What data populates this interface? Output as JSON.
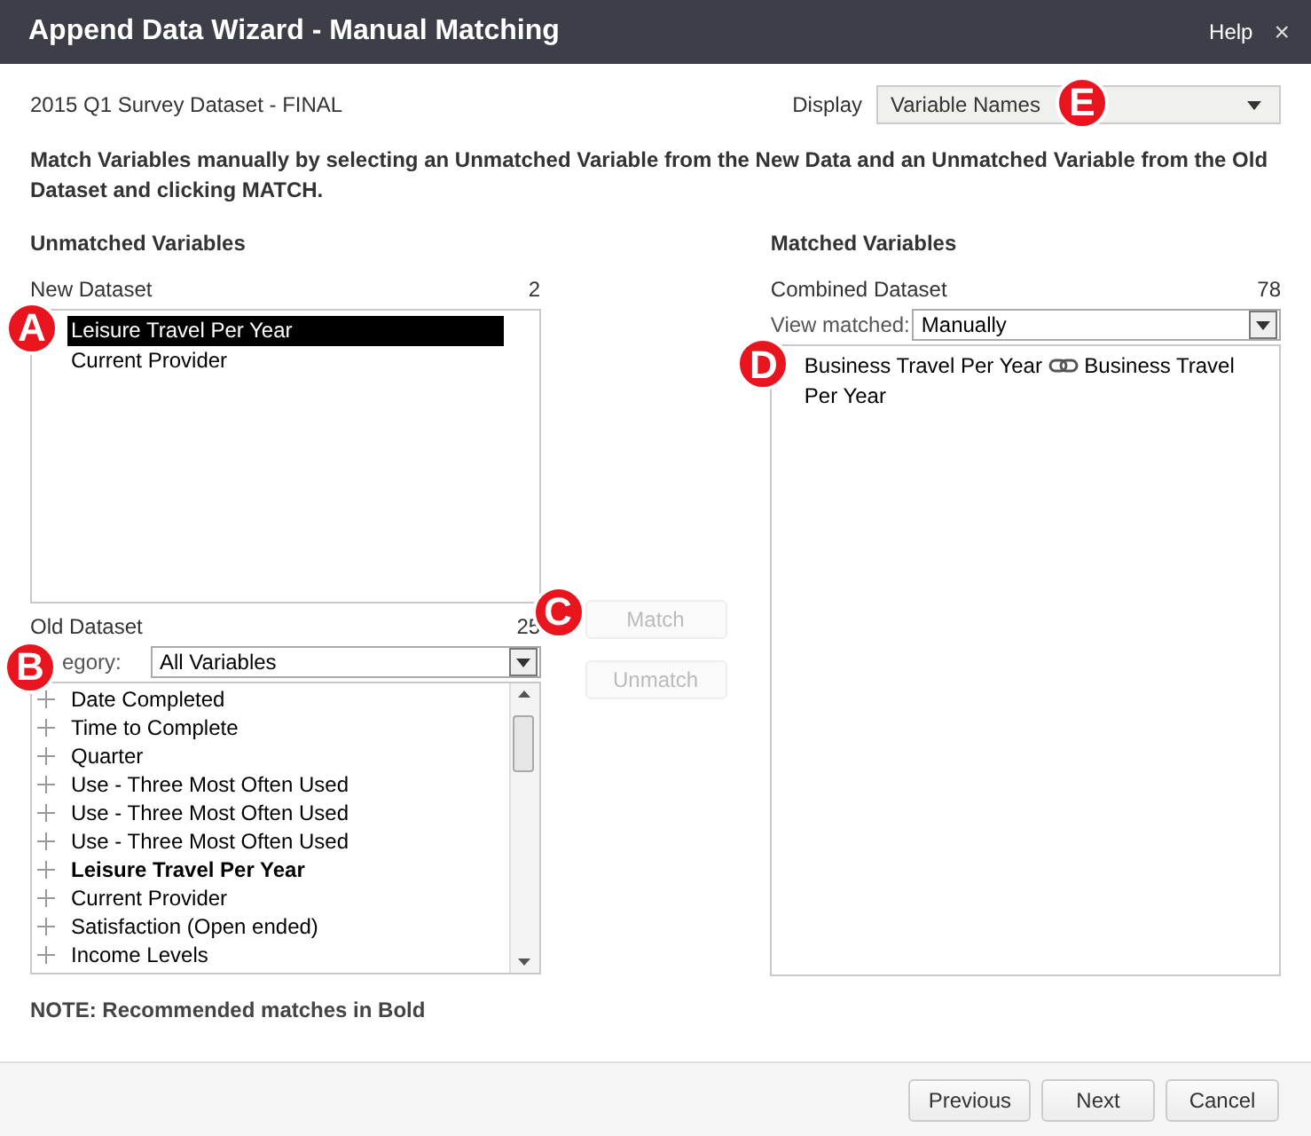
{
  "window": {
    "title": "Append Data Wizard - Manual Matching",
    "help": "Help",
    "close": "×"
  },
  "dataset_name": "2015 Q1 Survey Dataset - FINAL",
  "display": {
    "label": "Display",
    "value": "Variable Names"
  },
  "instructions": "Match Variables manually by selecting an Unmatched Variable from the New Data and an Unmatched Variable from the Old Dataset and clicking MATCH.",
  "unmatched": {
    "heading": "Unmatched Variables",
    "new_dataset": {
      "label": "New Dataset",
      "count": "2",
      "items": [
        {
          "name": "Leisure Travel Per Year",
          "selected": true
        },
        {
          "name": "Current Provider",
          "selected": false
        }
      ]
    },
    "old_dataset": {
      "label": "Old Dataset",
      "count": "25",
      "category_label": "egory:",
      "category": "All Variables",
      "items": [
        {
          "name": "Date Completed",
          "bold": false
        },
        {
          "name": "Time to Complete",
          "bold": false
        },
        {
          "name": "Quarter",
          "bold": false
        },
        {
          "name": "Use - Three Most Often Used",
          "bold": false
        },
        {
          "name": "Use - Three Most Often Used",
          "bold": false
        },
        {
          "name": "Use - Three Most Often Used",
          "bold": false
        },
        {
          "name": "Leisure Travel Per Year",
          "bold": true
        },
        {
          "name": "Current Provider",
          "bold": false
        },
        {
          "name": "Satisfaction (Open ended)",
          "bold": false
        },
        {
          "name": "Income Levels",
          "bold": false
        }
      ]
    }
  },
  "actions": [
    {
      "label": "Match",
      "disabled": true
    },
    {
      "label": "Unmatch",
      "disabled": true
    }
  ],
  "matched": {
    "heading": "Matched Variables",
    "combined_label": "Combined Dataset",
    "count": "78",
    "view_label": "View matched:",
    "view_value": "Manually",
    "pairs": [
      {
        "new": "Business Travel Per Year",
        "old": "Business Travel Per Year"
      }
    ]
  },
  "note": "NOTE: Recommended matches in Bold",
  "callouts": {
    "new_list": "A",
    "category": "B",
    "match": "C",
    "matched_list": "D",
    "display": "E"
  },
  "footer_buttons": [
    "Previous",
    "Next",
    "Cancel"
  ]
}
